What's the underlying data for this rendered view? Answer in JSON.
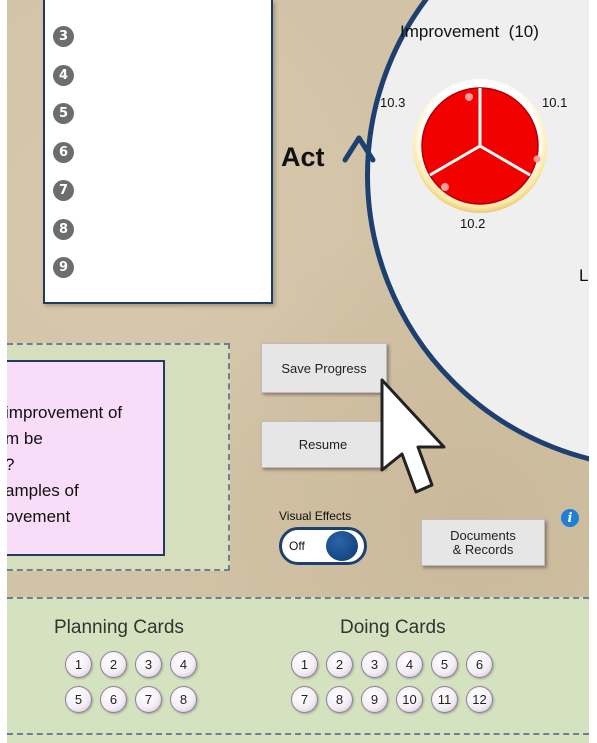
{
  "list": {
    "numbers": [
      "3",
      "4",
      "5",
      "6",
      "7",
      "8",
      "9"
    ]
  },
  "cycle": {
    "act_label": "Act",
    "improvement_title": "Improvement",
    "improvement_count": "(10)",
    "segments": [
      "10.1",
      "10.2",
      "10.3"
    ],
    "right_cut_label": "Le",
    "segment_color": "#ff0000",
    "ring_color": "#1d4070"
  },
  "note": {
    "lines": [
      "improvement of",
      "m be",
      "?",
      "amples of",
      "ovement"
    ]
  },
  "buttons": {
    "save_progress": "Save Progress",
    "resume": "Resume",
    "documents_line1": "Documents",
    "documents_line2": "& Records"
  },
  "visual_effects": {
    "label": "Visual Effects",
    "state": "Off"
  },
  "info_icon": "i",
  "planning_cards": {
    "title": "Planning Cards",
    "cards": [
      "1",
      "2",
      "3",
      "4",
      "5",
      "6",
      "7",
      "8"
    ]
  },
  "doing_cards": {
    "title": "Doing Cards",
    "cards": [
      "1",
      "2",
      "3",
      "4",
      "5",
      "6",
      "7",
      "8",
      "9",
      "10",
      "11",
      "12"
    ]
  }
}
